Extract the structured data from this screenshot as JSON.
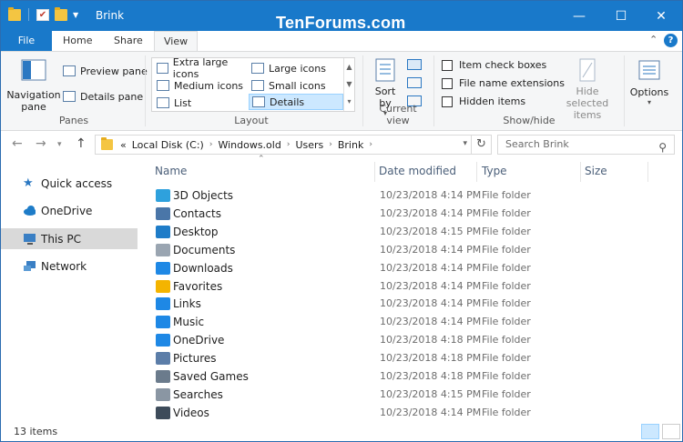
{
  "window": {
    "title": "Brink",
    "watermark": "TenForums.com"
  },
  "window_controls": {
    "minimize": "—",
    "maximize": "☐",
    "close": "✕"
  },
  "ribbon_tabs": [
    {
      "label": "File"
    },
    {
      "label": "Home"
    },
    {
      "label": "Share"
    },
    {
      "label": "View"
    }
  ],
  "ribbon": {
    "panes": {
      "navigation_pane": "Navigation pane",
      "preview_pane": "Preview pane",
      "details_pane": "Details pane",
      "group_label": "Panes"
    },
    "layout": {
      "items": [
        "Extra large icons",
        "Large icons",
        "Medium icons",
        "Small icons",
        "List",
        "Details"
      ],
      "selected": "Details",
      "group_label": "Layout"
    },
    "current_view": {
      "sort_by": "Sort by",
      "group_label": "Current view"
    },
    "show_hide": {
      "item_check_boxes": "Item check boxes",
      "file_name_extensions": "File name extensions",
      "hidden_items": "Hidden items",
      "hide_selected": "Hide selected items",
      "group_label": "Show/hide"
    },
    "options": "Options"
  },
  "address_bar": {
    "prefix": "«",
    "crumbs": [
      "Local Disk (C:)",
      "Windows.old",
      "Users",
      "Brink"
    ],
    "search_placeholder": "Search Brink"
  },
  "nav_pane": {
    "items": [
      {
        "label": "Quick access",
        "icon": "star-icon"
      },
      {
        "label": "OneDrive",
        "icon": "cloud-icon"
      },
      {
        "label": "This PC",
        "icon": "computer-icon",
        "selected": true
      },
      {
        "label": "Network",
        "icon": "network-icon"
      }
    ]
  },
  "columns": [
    "Name",
    "Date modified",
    "Type",
    "Size"
  ],
  "files": [
    {
      "name": "3D Objects",
      "date": "10/23/2018 4:14 PM",
      "type": "File folder",
      "color": "#2ea1dd"
    },
    {
      "name": "Contacts",
      "date": "10/23/2018 4:14 PM",
      "type": "File folder",
      "color": "#4a76a8"
    },
    {
      "name": "Desktop",
      "date": "10/23/2018 4:15 PM",
      "type": "File folder",
      "color": "#1e7cc8"
    },
    {
      "name": "Documents",
      "date": "10/23/2018 4:14 PM",
      "type": "File folder",
      "color": "#9aa5b1"
    },
    {
      "name": "Downloads",
      "date": "10/23/2018 4:14 PM",
      "type": "File folder",
      "color": "#1e88e5"
    },
    {
      "name": "Favorites",
      "date": "10/23/2018 4:14 PM",
      "type": "File folder",
      "color": "#f4b400"
    },
    {
      "name": "Links",
      "date": "10/23/2018 4:14 PM",
      "type": "File folder",
      "color": "#1e88e5"
    },
    {
      "name": "Music",
      "date": "10/23/2018 4:14 PM",
      "type": "File folder",
      "color": "#1e88e5"
    },
    {
      "name": "OneDrive",
      "date": "10/23/2018 4:18 PM",
      "type": "File folder",
      "color": "#1e88e5"
    },
    {
      "name": "Pictures",
      "date": "10/23/2018 4:18 PM",
      "type": "File folder",
      "color": "#5b7da8"
    },
    {
      "name": "Saved Games",
      "date": "10/23/2018 4:18 PM",
      "type": "File folder",
      "color": "#6b7b8c"
    },
    {
      "name": "Searches",
      "date": "10/23/2018 4:15 PM",
      "type": "File folder",
      "color": "#8a96a3"
    },
    {
      "name": "Videos",
      "date": "10/23/2018 4:14 PM",
      "type": "File folder",
      "color": "#3d4b5a"
    }
  ],
  "status": {
    "item_count": "13 items"
  },
  "colors": {
    "accent": "#1979ca",
    "selected_bg": "#cce8ff",
    "nav_selected": "#d9d9d9"
  }
}
